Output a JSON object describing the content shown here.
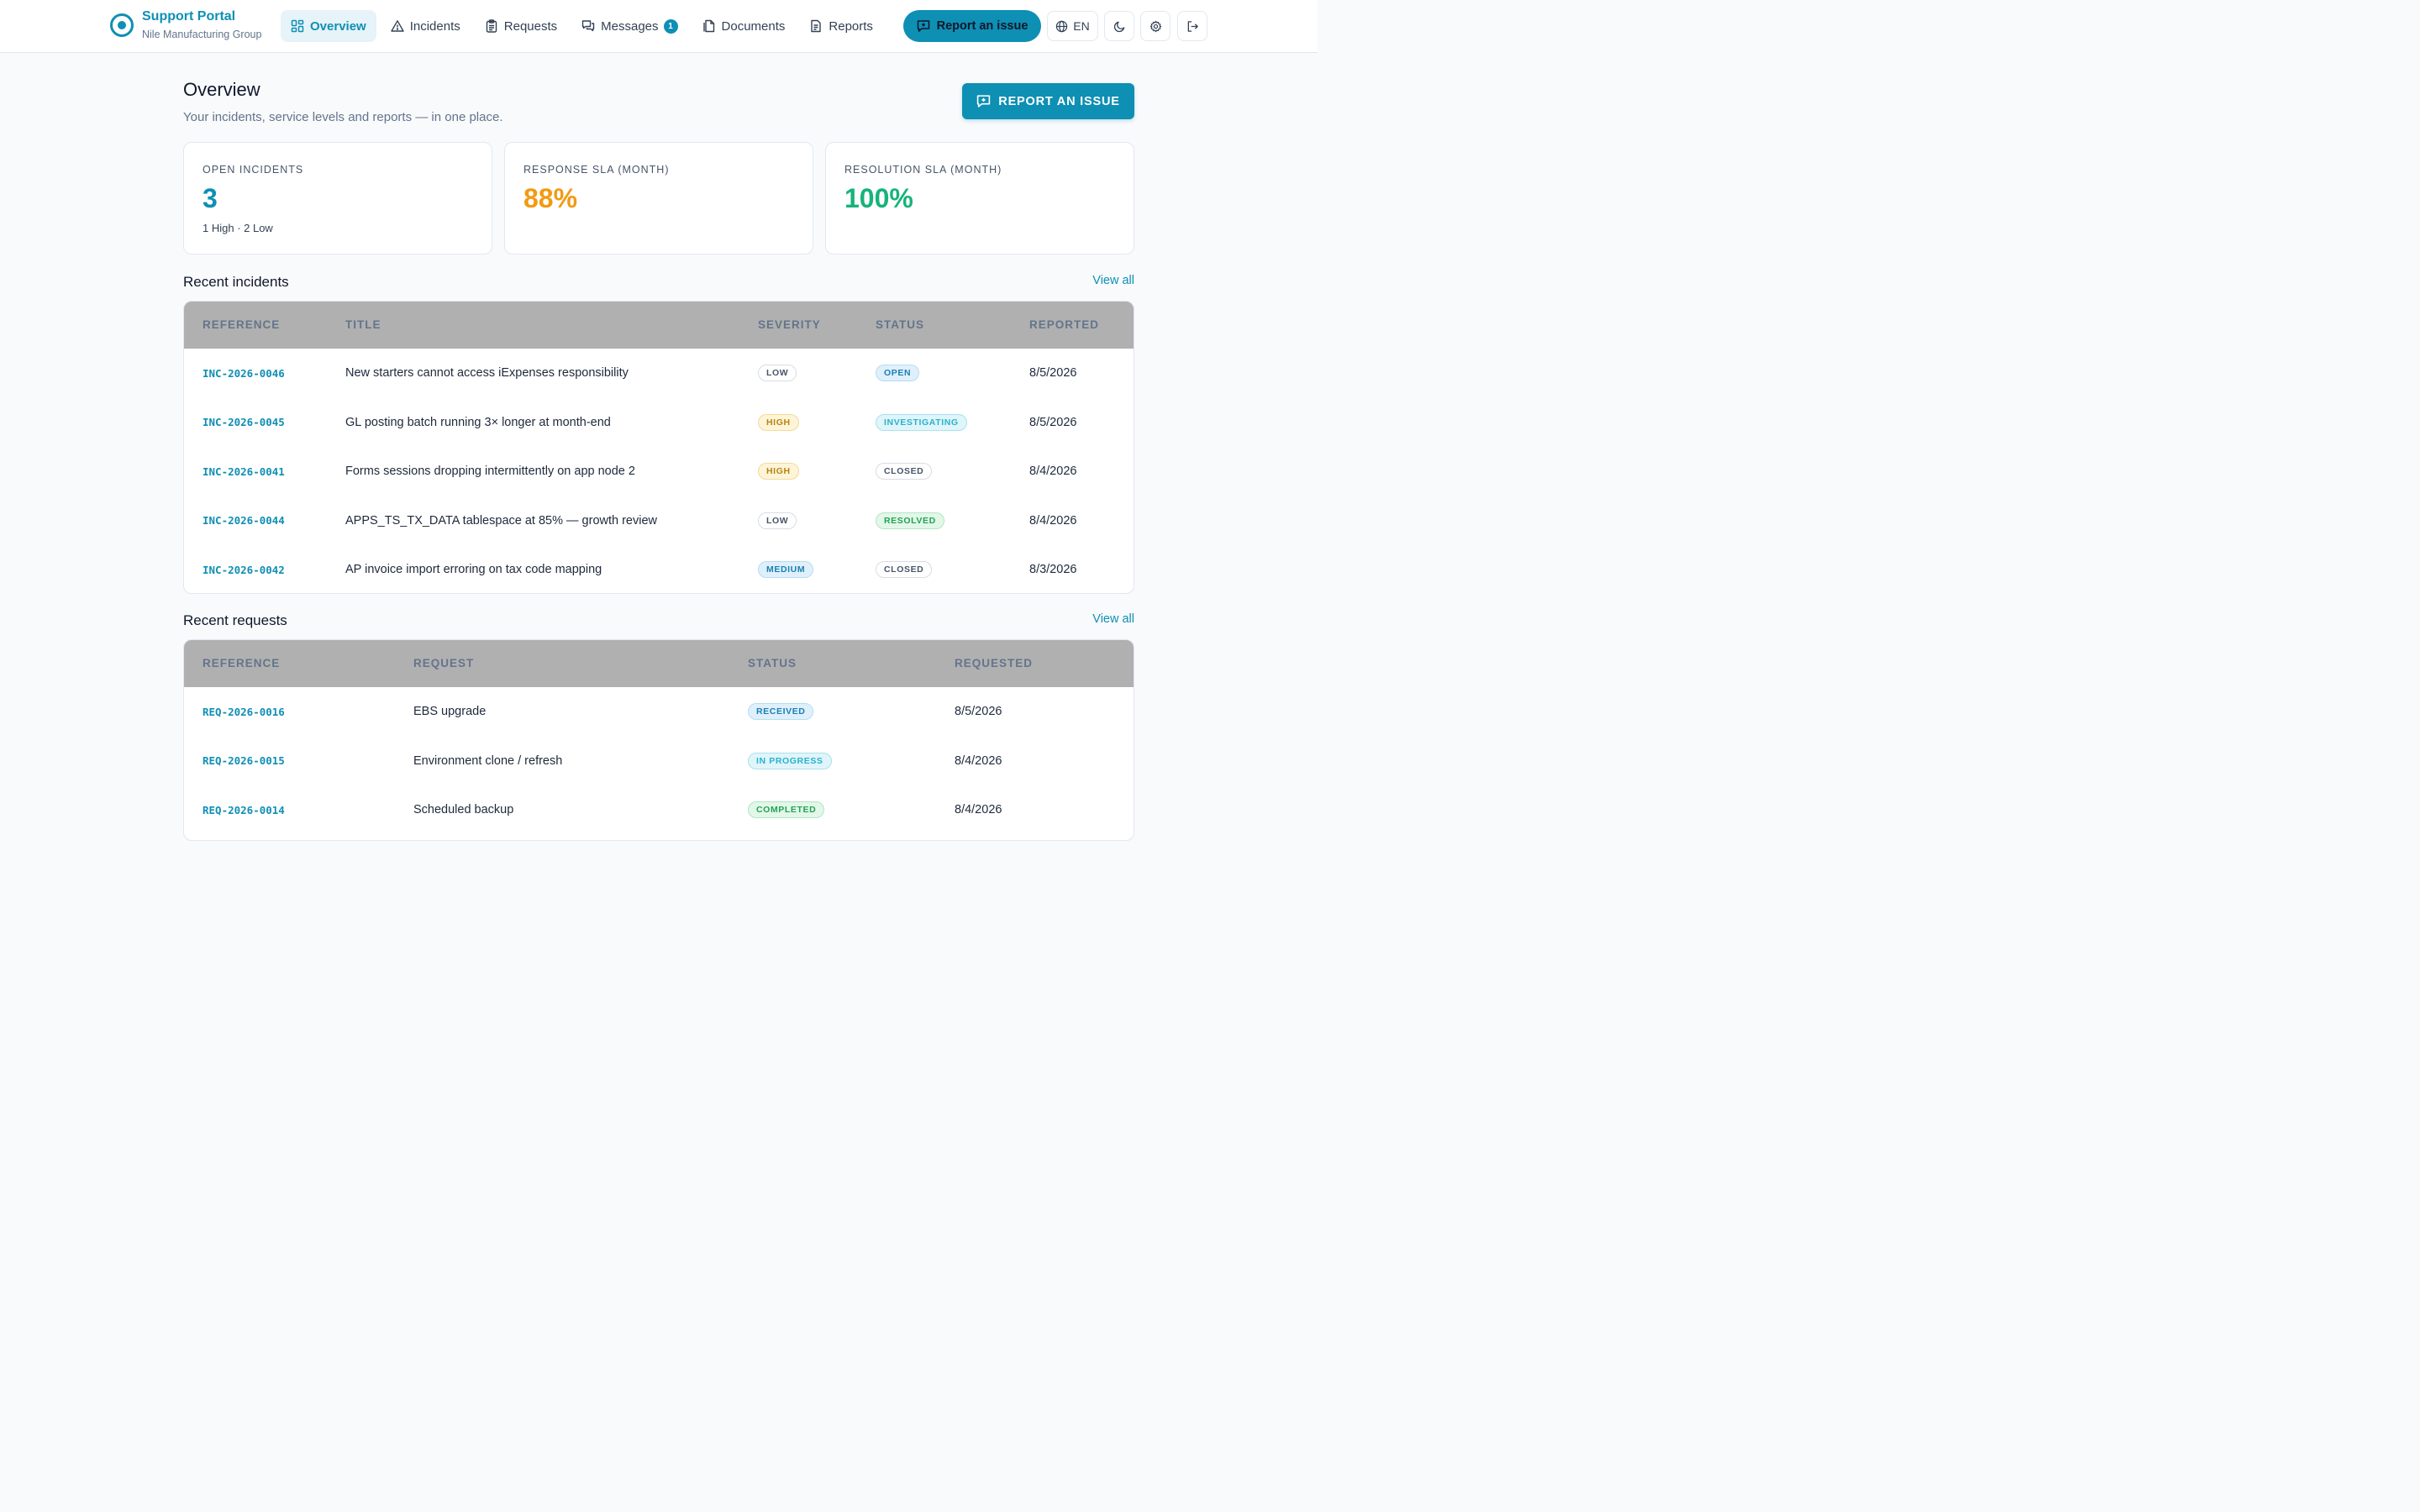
{
  "brand": {
    "title": "Support Portal",
    "subtitle": "Nile Manufacturing Group"
  },
  "nav": {
    "items": [
      {
        "label": "Overview",
        "icon": "grid-icon",
        "active": true
      },
      {
        "label": "Incidents",
        "icon": "warning-triangle-icon"
      },
      {
        "label": "Requests",
        "icon": "clipboard-icon"
      },
      {
        "label": "Messages",
        "icon": "chat-bubbles-icon",
        "badge": "1"
      },
      {
        "label": "Documents",
        "icon": "documents-icon"
      },
      {
        "label": "Reports",
        "icon": "report-file-icon"
      }
    ],
    "report_label": "Report an issue",
    "language": "EN"
  },
  "page": {
    "title": "Overview",
    "subtitle": "Your incidents, service levels and reports — in one place.",
    "report_button": "REPORT AN ISSUE"
  },
  "stats": [
    {
      "label": "OPEN INCIDENTS",
      "value": "3",
      "note": "1 High · 2 Low",
      "color": "#0e8fb4"
    },
    {
      "label": "RESPONSE SLA (MONTH)",
      "value": "88%",
      "note": "",
      "color": "#f29a12"
    },
    {
      "label": "RESOLUTION SLA (MONTH)",
      "value": "100%",
      "note": "",
      "color": "#16b37a"
    }
  ],
  "incidents": {
    "title": "Recent incidents",
    "view_all": "View all",
    "columns": [
      "REFERENCE",
      "TITLE",
      "SEVERITY",
      "STATUS",
      "REPORTED"
    ],
    "rows": [
      {
        "ref": "INC-2026-0046",
        "title": "New starters cannot access iExpenses responsibility",
        "severity": "LOW",
        "status": "OPEN",
        "date": "8/5/2026"
      },
      {
        "ref": "INC-2026-0045",
        "title": "GL posting batch running 3× longer at month-end",
        "severity": "HIGH",
        "status": "INVESTIGATING",
        "date": "8/5/2026"
      },
      {
        "ref": "INC-2026-0041",
        "title": "Forms sessions dropping intermittently on app node 2",
        "severity": "HIGH",
        "status": "CLOSED",
        "date": "8/4/2026"
      },
      {
        "ref": "INC-2026-0044",
        "title": "APPS_TS_TX_DATA tablespace at 85% — growth review",
        "severity": "LOW",
        "status": "RESOLVED",
        "date": "8/4/2026"
      },
      {
        "ref": "INC-2026-0042",
        "title": "AP invoice import erroring on tax code mapping",
        "severity": "MEDIUM",
        "status": "CLOSED",
        "date": "8/3/2026"
      }
    ]
  },
  "requests": {
    "title": "Recent requests",
    "view_all": "View all",
    "columns": [
      "REFERENCE",
      "REQUEST",
      "STATUS",
      "REQUESTED"
    ],
    "rows": [
      {
        "ref": "REQ-2026-0016",
        "request": "EBS upgrade",
        "status": "RECEIVED",
        "date": "8/5/2026"
      },
      {
        "ref": "REQ-2026-0015",
        "request": "Environment clone / refresh",
        "status": "IN PROGRESS",
        "date": "8/4/2026"
      },
      {
        "ref": "REQ-2026-0014",
        "request": "Scheduled backup",
        "status": "COMPLETED",
        "date": "8/4/2026"
      }
    ]
  },
  "pill_colors": {
    "LOW": {
      "bg": "#ffffff",
      "fg": "#475569",
      "border": "#d7dde5"
    },
    "HIGH": {
      "bg": "#fdf4d9",
      "fg": "#b8860b",
      "border": "#f3dc94"
    },
    "MEDIUM": {
      "bg": "#dff0fb",
      "fg": "#1a7fb5",
      "border": "#b5dcf2"
    },
    "OPEN": {
      "bg": "#dff0fb",
      "fg": "#1a7fb5",
      "border": "#b5dcf2"
    },
    "INVESTIGATING": {
      "bg": "#e0f5fa",
      "fg": "#27b3cf",
      "border": "#a9e1ee"
    },
    "CLOSED": {
      "bg": "#ffffff",
      "fg": "#475569",
      "border": "#d7dde5"
    },
    "RESOLVED": {
      "bg": "#e3f7e9",
      "fg": "#22a355",
      "border": "#b2e5c3"
    },
    "RECEIVED": {
      "bg": "#dff0fb",
      "fg": "#1a7fb5",
      "border": "#b5dcf2"
    },
    "IN PROGRESS": {
      "bg": "#e0f5fa",
      "fg": "#27b3cf",
      "border": "#a9e1ee"
    },
    "COMPLETED": {
      "bg": "#e3f7e9",
      "fg": "#22a355",
      "border": "#b2e5c3"
    }
  }
}
